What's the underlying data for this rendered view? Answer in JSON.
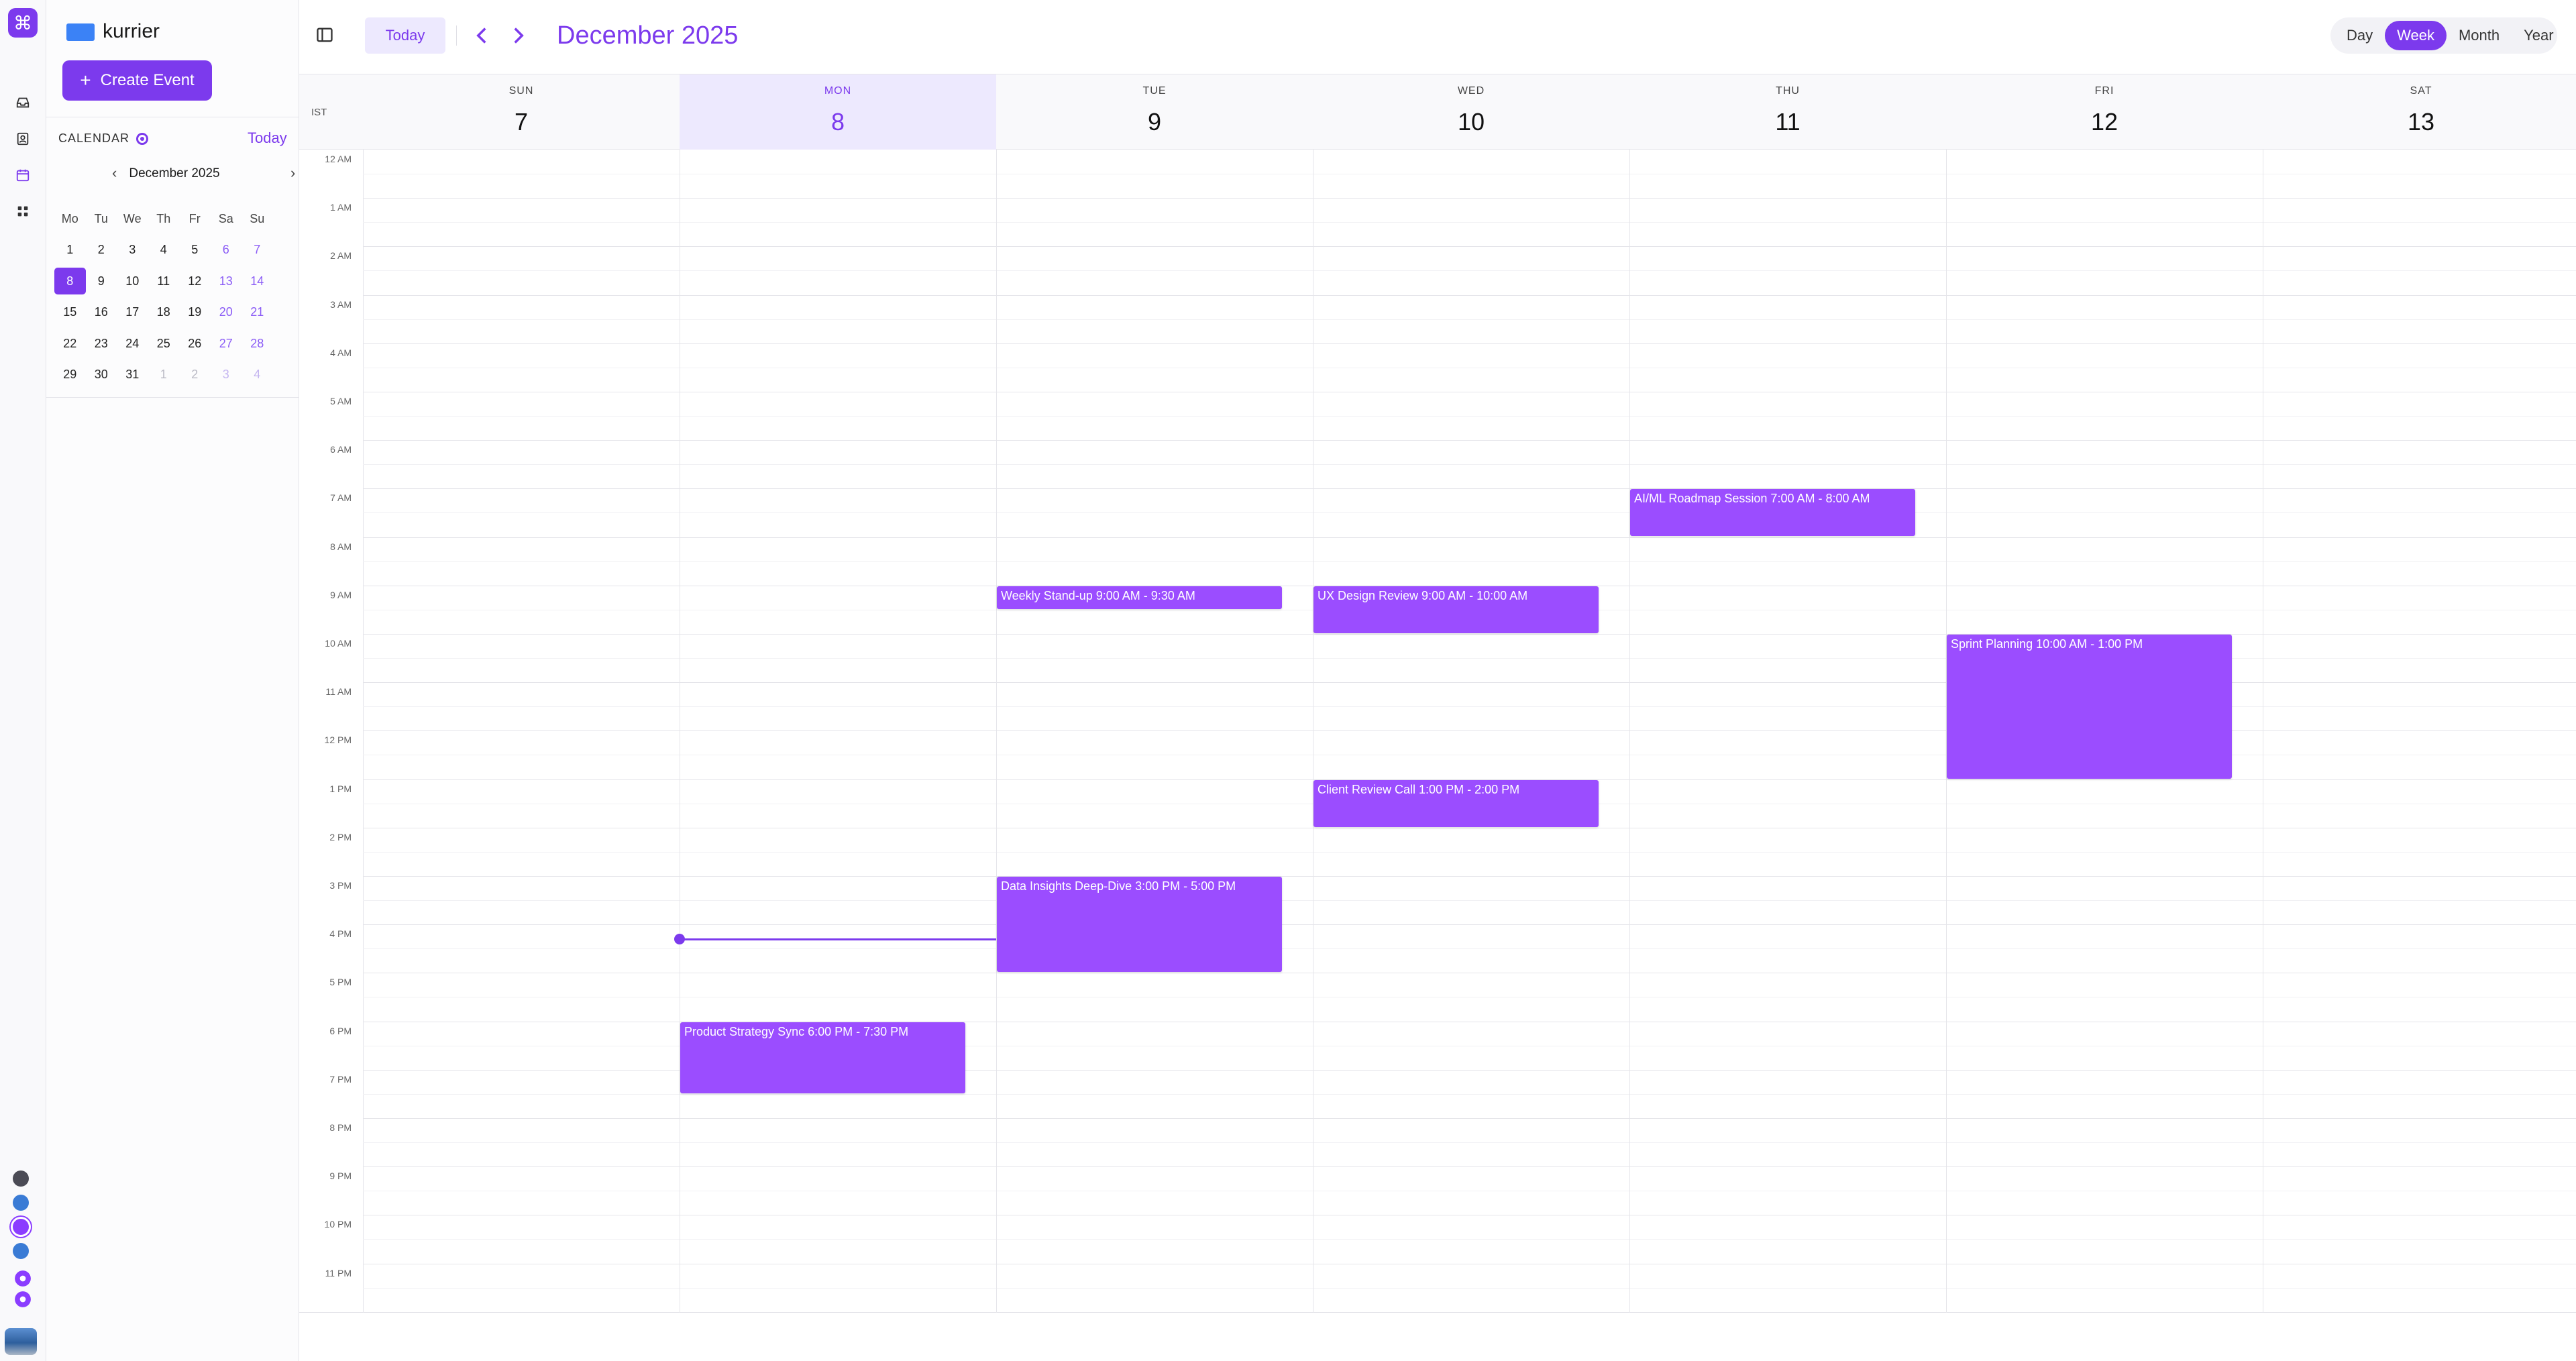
{
  "app": {
    "name": "kurrier",
    "create_label": "Create Event"
  },
  "rail": {
    "icons": [
      "command-icon",
      "inbox-icon",
      "contacts-icon",
      "calendar-icon",
      "apps-icon"
    ],
    "theme_dots": [
      "#4b4b55",
      "#3a7bd5",
      "#8b3dff",
      "#3a7bd5"
    ]
  },
  "sidebar": {
    "calendar_label": "CALENDAR",
    "today_label": "Today",
    "mini_month": "December 2025",
    "dow": [
      "Mo",
      "Tu",
      "We",
      "Th",
      "Fr",
      "Sa",
      "Su"
    ],
    "weeks": [
      [
        {
          "d": "1"
        },
        {
          "d": "2"
        },
        {
          "d": "3"
        },
        {
          "d": "4"
        },
        {
          "d": "5"
        },
        {
          "d": "6",
          "w": true
        },
        {
          "d": "7",
          "w": true
        }
      ],
      [
        {
          "d": "8",
          "today": true
        },
        {
          "d": "9"
        },
        {
          "d": "10"
        },
        {
          "d": "11"
        },
        {
          "d": "12"
        },
        {
          "d": "13",
          "w": true
        },
        {
          "d": "14",
          "w": true
        }
      ],
      [
        {
          "d": "15"
        },
        {
          "d": "16"
        },
        {
          "d": "17"
        },
        {
          "d": "18"
        },
        {
          "d": "19"
        },
        {
          "d": "20",
          "w": true
        },
        {
          "d": "21",
          "w": true
        }
      ],
      [
        {
          "d": "22"
        },
        {
          "d": "23"
        },
        {
          "d": "24"
        },
        {
          "d": "25"
        },
        {
          "d": "26"
        },
        {
          "d": "27",
          "w": true
        },
        {
          "d": "28",
          "w": true
        }
      ],
      [
        {
          "d": "29"
        },
        {
          "d": "30"
        },
        {
          "d": "31"
        },
        {
          "d": "1",
          "o": true
        },
        {
          "d": "2",
          "o": true
        },
        {
          "d": "3",
          "o": true,
          "w": true
        },
        {
          "d": "4",
          "o": true,
          "w": true
        }
      ]
    ]
  },
  "toolbar": {
    "today_label": "Today",
    "title": "December 2025",
    "views": [
      "Day",
      "Week",
      "Month",
      "Year"
    ],
    "active_view": "Week"
  },
  "week": {
    "timezone": "IST",
    "days": [
      {
        "dow": "SUN",
        "num": "7"
      },
      {
        "dow": "MON",
        "num": "8",
        "today": true
      },
      {
        "dow": "TUE",
        "num": "9"
      },
      {
        "dow": "WED",
        "num": "10"
      },
      {
        "dow": "THU",
        "num": "11"
      },
      {
        "dow": "FRI",
        "num": "12"
      },
      {
        "dow": "SAT",
        "num": "13"
      }
    ],
    "hours": [
      "12 AM",
      "1 AM",
      "2 AM",
      "3 AM",
      "4 AM",
      "5 AM",
      "6 AM",
      "7 AM",
      "8 AM",
      "9 AM",
      "10 AM",
      "11 AM",
      "12 PM",
      "1 PM",
      "2 PM",
      "3 PM",
      "4 PM",
      "5 PM",
      "6 PM",
      "7 PM",
      "8 PM",
      "9 PM",
      "10 PM",
      "11 PM"
    ],
    "now_hour": 16.3
  },
  "events": [
    {
      "title": "AI/ML Roadmap Session 7:00 AM - 8:00 AM",
      "day": 4,
      "start": 7,
      "end": 8
    },
    {
      "title": "Weekly Stand-up 9:00 AM - 9:30 AM",
      "day": 2,
      "start": 9,
      "end": 9.5
    },
    {
      "title": "UX Design Review 9:00 AM - 10:00 AM",
      "day": 3,
      "start": 9,
      "end": 10
    },
    {
      "title": "Sprint Planning 10:00 AM - 1:00 PM",
      "day": 5,
      "start": 10,
      "end": 13
    },
    {
      "title": "Client Review Call 1:00 PM - 2:00 PM",
      "day": 3,
      "start": 13,
      "end": 14
    },
    {
      "title": "Data Insights Deep-Dive 3:00 PM - 5:00 PM",
      "day": 2,
      "start": 15,
      "end": 17
    },
    {
      "title": "Product Strategy Sync 6:00 PM - 7:30 PM",
      "day": 1,
      "start": 18,
      "end": 19.5
    }
  ]
}
